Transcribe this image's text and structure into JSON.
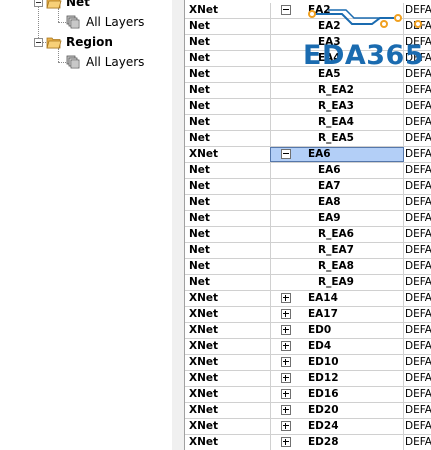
{
  "tree": {
    "items": [
      {
        "label": "Net",
        "kind": "folder"
      },
      {
        "label": "All Layers",
        "kind": "layers"
      },
      {
        "label": "Region",
        "kind": "folder"
      },
      {
        "label": "All Layers",
        "kind": "layers"
      }
    ]
  },
  "grid": {
    "rows": [
      {
        "type": "XNet",
        "name": "EA2",
        "expander": "minus",
        "cls": "DEFA"
      },
      {
        "type": "Net",
        "name": "EA2",
        "expander": "",
        "cls": "DEFA"
      },
      {
        "type": "Net",
        "name": "EA3",
        "expander": "",
        "cls": "DEFA"
      },
      {
        "type": "Net",
        "name": "EA4",
        "expander": "",
        "cls": "DEFA"
      },
      {
        "type": "Net",
        "name": "EA5",
        "expander": "",
        "cls": "DEFA"
      },
      {
        "type": "Net",
        "name": "R_EA2",
        "expander": "",
        "cls": "DEFA"
      },
      {
        "type": "Net",
        "name": "R_EA3",
        "expander": "",
        "cls": "DEFA"
      },
      {
        "type": "Net",
        "name": "R_EA4",
        "expander": "",
        "cls": "DEFA"
      },
      {
        "type": "Net",
        "name": "R_EA5",
        "expander": "",
        "cls": "DEFA"
      },
      {
        "type": "XNet",
        "name": "EA6",
        "expander": "minus",
        "cls": "DEFA",
        "selected": true
      },
      {
        "type": "Net",
        "name": "EA6",
        "expander": "",
        "cls": "DEFA"
      },
      {
        "type": "Net",
        "name": "EA7",
        "expander": "",
        "cls": "DEFA"
      },
      {
        "type": "Net",
        "name": "EA8",
        "expander": "",
        "cls": "DEFA"
      },
      {
        "type": "Net",
        "name": "EA9",
        "expander": "",
        "cls": "DEFA"
      },
      {
        "type": "Net",
        "name": "R_EA6",
        "expander": "",
        "cls": "DEFA"
      },
      {
        "type": "Net",
        "name": "R_EA7",
        "expander": "",
        "cls": "DEFA"
      },
      {
        "type": "Net",
        "name": "R_EA8",
        "expander": "",
        "cls": "DEFA"
      },
      {
        "type": "Net",
        "name": "R_EA9",
        "expander": "",
        "cls": "DEFA"
      },
      {
        "type": "XNet",
        "name": "EA14",
        "expander": "plus",
        "cls": "DEFA"
      },
      {
        "type": "XNet",
        "name": "EA17",
        "expander": "plus",
        "cls": "DEFA"
      },
      {
        "type": "XNet",
        "name": "ED0",
        "expander": "plus",
        "cls": "DEFA"
      },
      {
        "type": "XNet",
        "name": "ED4",
        "expander": "plus",
        "cls": "DEFA"
      },
      {
        "type": "XNet",
        "name": "ED10",
        "expander": "plus",
        "cls": "DEFA"
      },
      {
        "type": "XNet",
        "name": "ED12",
        "expander": "plus",
        "cls": "DEFA"
      },
      {
        "type": "XNet",
        "name": "ED16",
        "expander": "plus",
        "cls": "DEFA"
      },
      {
        "type": "XNet",
        "name": "ED20",
        "expander": "plus",
        "cls": "DEFA"
      },
      {
        "type": "XNet",
        "name": "ED24",
        "expander": "plus",
        "cls": "DEFA"
      },
      {
        "type": "XNet",
        "name": "ED28",
        "expander": "plus",
        "cls": "DEFA"
      }
    ]
  },
  "watermark": {
    "text": "EDA365"
  },
  "colors": {
    "selection": "#b3cff7",
    "watermark": "#1a6bb0",
    "watermark_orange": "#f0a020"
  }
}
